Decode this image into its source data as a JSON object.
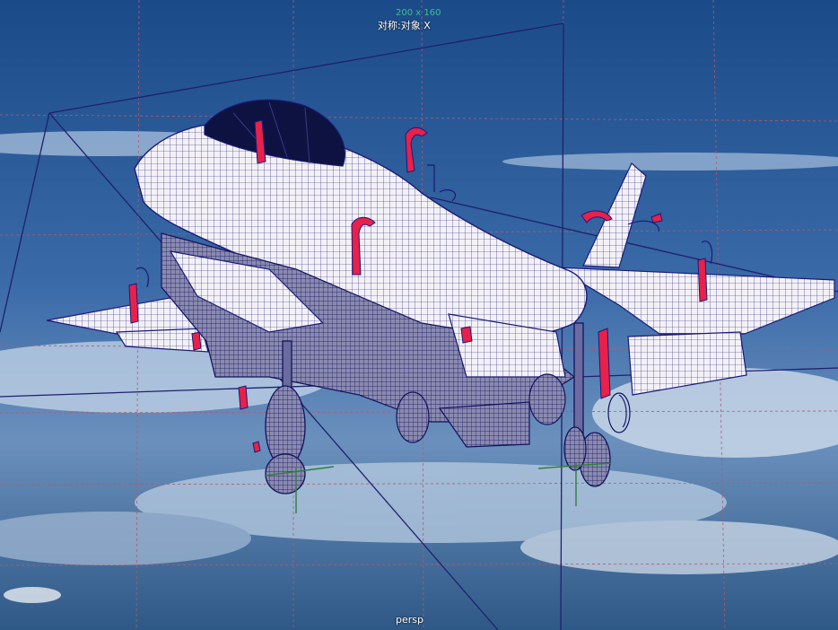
{
  "viewport": {
    "camera_name": "persp",
    "symmetry_label": "对称:对象 X",
    "resolution_gate": "200 x 160"
  },
  "colors": {
    "sky_top": "#1e4e8c",
    "sky_bottom": "#5f87ba",
    "wireframe": "#1a1a7a",
    "mesh_surface": "#f2f0f5",
    "grid": "#b45a6a",
    "manipulator": "#e8204a",
    "camera_frustum": "#20206e",
    "pivot": "#2f7f3f"
  }
}
